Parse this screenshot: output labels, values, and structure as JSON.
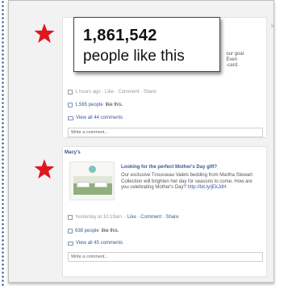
{
  "callout": {
    "count": "1,861,542",
    "text": "people like this"
  },
  "post1": {
    "partial_text": [
      "our goal",
      "Even",
      "-card."
    ],
    "meta": "1 hours ago · Like · Comment · Share",
    "likes_link": "1,565 people",
    "likes_suffix": "like this.",
    "view_comments": "View all 44 comments",
    "comment_placeholder": "Write a comment..."
  },
  "post2": {
    "page_name": "Macy's",
    "headline": "Looking for the perfect Mother's Day gift?",
    "body_lines": [
      "Our exclusive Trousseau Valets bedding from Martha Stewart",
      "Collection will brighten her day for seasons to come. How are",
      "you celebrating Mother's Day?"
    ],
    "body_link": "http://bit.ly/jEkJdH",
    "meta_time": "Yesterday at 10:19am",
    "meta_actions": "· Like · Comment · Share",
    "likes_link": "638 people",
    "likes_suffix": "like this.",
    "view_comments": "View all 45 comments",
    "comment_placeholder": "Write a comment..."
  },
  "close_symbol": "×",
  "colors": {
    "link": "#3b5998",
    "star": "#e0161f",
    "panel_bg": "#f2f2f2"
  },
  "icons": [
    "star-icon",
    "thumbs-up-icon",
    "comment-bubble-icon",
    "close-icon"
  ]
}
